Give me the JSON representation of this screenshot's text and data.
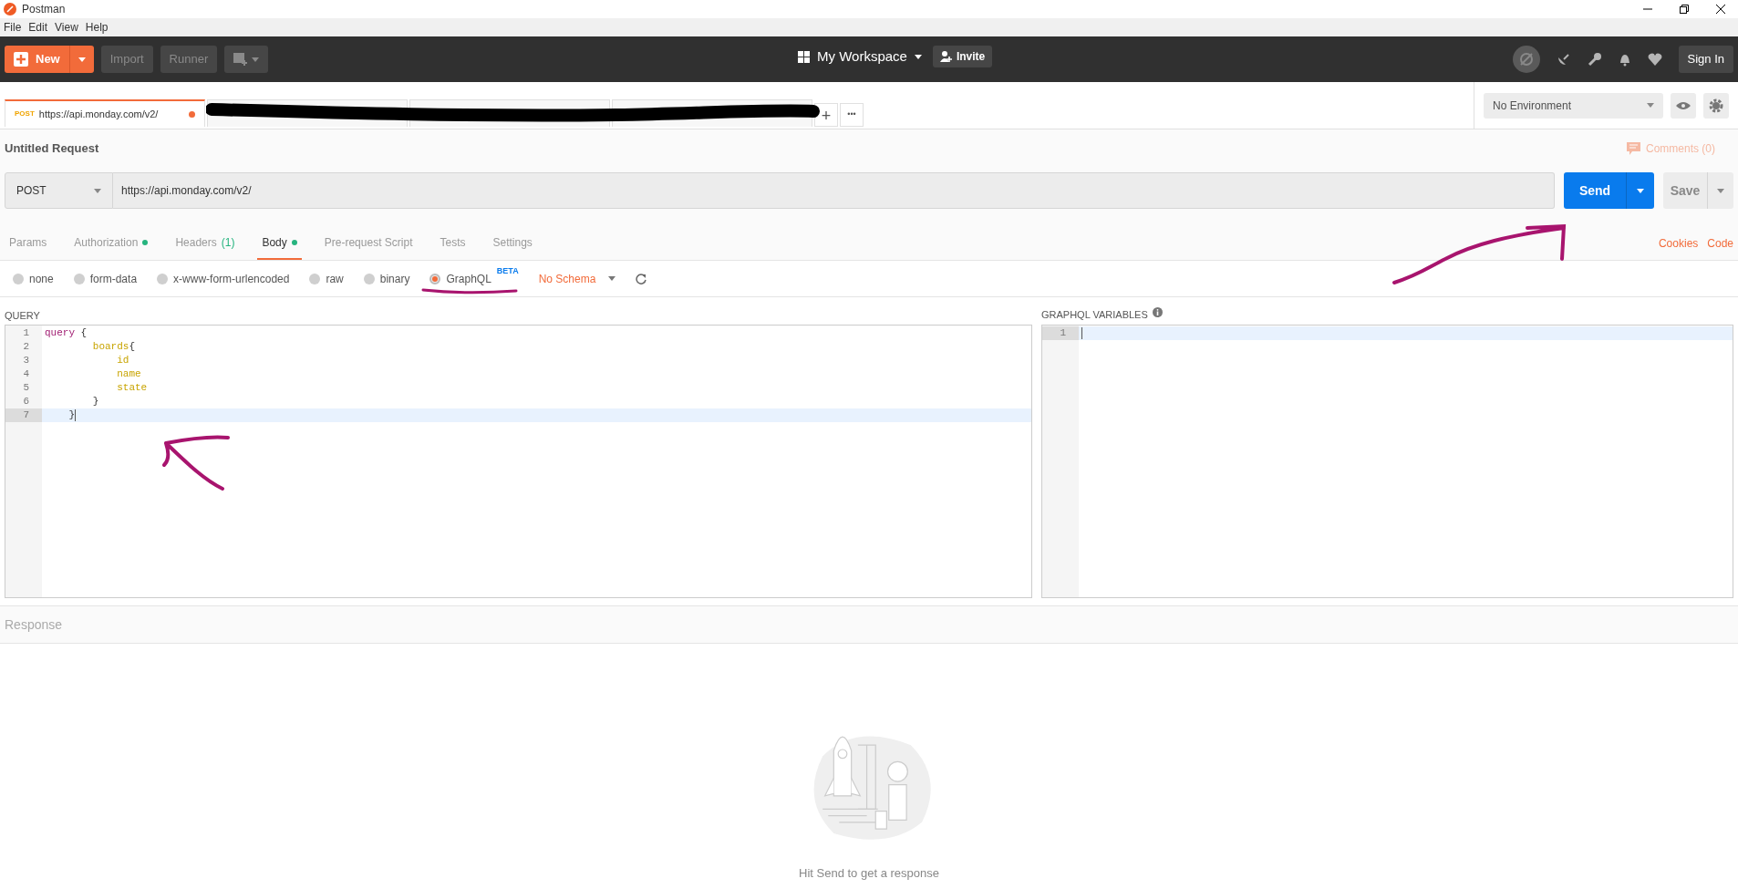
{
  "window": {
    "title": "Postman"
  },
  "menu": [
    "File",
    "Edit",
    "View",
    "Help"
  ],
  "header": {
    "new_label": "New",
    "import_label": "Import",
    "runner_label": "Runner",
    "workspace": "My Workspace",
    "invite": "Invite",
    "sign_in": "Sign In"
  },
  "request_tabs": [
    {
      "method": "POST",
      "url": "https://api.monday.com/v2/",
      "unsaved": true,
      "selected": true
    },
    {
      "selected": false
    },
    {
      "selected": false
    },
    {
      "selected": false
    }
  ],
  "new_tab": "+",
  "more_tabs": "•••",
  "environment": {
    "value": "No Environment"
  },
  "request": {
    "name": "Untitled Request",
    "comments": "Comments (0)",
    "method": "POST",
    "url": "https://api.monday.com/v2/",
    "send": "Send",
    "save": "Save"
  },
  "option_tabs": [
    {
      "label": "Params",
      "selected": false,
      "dot": false
    },
    {
      "label": "Authorization",
      "selected": false,
      "dot": true
    },
    {
      "label": "Headers",
      "selected": false,
      "dot": false,
      "count": "(1)"
    },
    {
      "label": "Body",
      "selected": true,
      "dot": true
    },
    {
      "label": "Pre-request Script",
      "selected": false,
      "dot": false
    },
    {
      "label": "Tests",
      "selected": false,
      "dot": false
    },
    {
      "label": "Settings",
      "selected": false,
      "dot": false
    }
  ],
  "links": [
    "Cookies",
    "Code"
  ],
  "body_types": [
    {
      "label": "none",
      "selected": false
    },
    {
      "label": "form-data",
      "selected": false
    },
    {
      "label": "x-www-form-urlencoded",
      "selected": false
    },
    {
      "label": "raw",
      "selected": false
    },
    {
      "label": "binary",
      "selected": false
    },
    {
      "label": "GraphQL",
      "selected": true,
      "badge": "BETA"
    }
  ],
  "schema": "No Schema",
  "query": {
    "title": "QUERY",
    "lines": [
      {
        "number": "1",
        "active": false,
        "tokens": [
          {
            "text": "query",
            "kind": "keyword"
          },
          {
            "text": " {",
            "kind": "punct"
          }
        ]
      },
      {
        "number": "2",
        "active": false,
        "tokens": [
          {
            "text": "        boards",
            "kind": "field"
          },
          {
            "text": "{",
            "kind": "punct"
          }
        ]
      },
      {
        "number": "3",
        "active": false,
        "tokens": [
          {
            "text": "            id",
            "kind": "field"
          }
        ]
      },
      {
        "number": "4",
        "active": false,
        "tokens": [
          {
            "text": "            name",
            "kind": "field"
          }
        ]
      },
      {
        "number": "5",
        "active": false,
        "tokens": [
          {
            "text": "            state",
            "kind": "field"
          }
        ]
      },
      {
        "number": "6",
        "active": false,
        "tokens": [
          {
            "text": "        }",
            "kind": "punct"
          }
        ]
      },
      {
        "number": "7",
        "active": true,
        "tokens": [
          {
            "text": "    }",
            "kind": "punct"
          }
        ]
      }
    ]
  },
  "variables": {
    "title": "GRAPHQL VARIABLES",
    "lines": [
      {
        "number": "1",
        "active": true
      }
    ]
  },
  "response": {
    "title": "Response",
    "hint": "Hit Send to get a response"
  }
}
